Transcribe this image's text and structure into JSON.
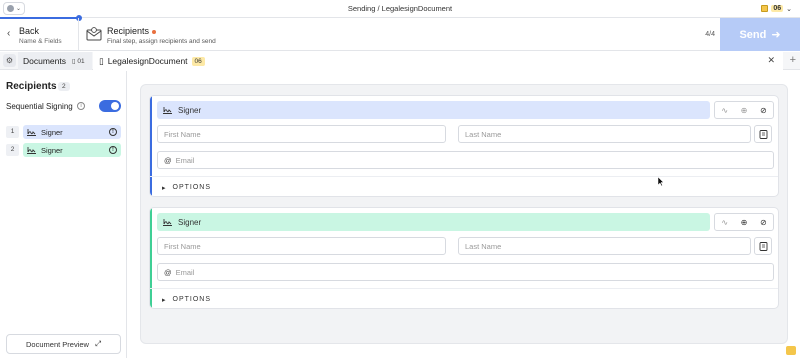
{
  "topbar": {
    "title": "Sending / LegalesignDocument",
    "credits": "06"
  },
  "header": {
    "back_label": "Back",
    "back_sub": "Name & Fields",
    "step_title": "Recipients",
    "step_sub": "Final step, assign recipients and send",
    "step_count": "4/4",
    "send_label": "Send"
  },
  "tabs": {
    "docs_label": "Documents",
    "docs_count": "01",
    "doc_name": "LegalesignDocument",
    "doc_badge": "06"
  },
  "sidebar": {
    "title": "Recipients",
    "count": "2",
    "sequential_label": "Sequential Signing",
    "recipients": [
      {
        "num": "1",
        "role": "Signer"
      },
      {
        "num": "2",
        "role": "Signer"
      }
    ],
    "preview_label": "Document Preview"
  },
  "cards": [
    {
      "role": "Signer",
      "first_placeholder": "First Name",
      "last_placeholder": "Last Name",
      "email_placeholder": "Email",
      "options_label": "OPTIONS"
    },
    {
      "role": "Signer",
      "first_placeholder": "First Name",
      "last_placeholder": "Last Name",
      "email_placeholder": "Email",
      "options_label": "OPTIONS"
    }
  ],
  "colors": {
    "accent": "#3b6ce0",
    "signer1_bg": "#dbe5fd",
    "signer1_accent": "#3b6ce0",
    "signer2_bg": "#c9f6e3",
    "signer2_accent": "#3fcf95",
    "send_disabled": "#b6cbf7"
  }
}
